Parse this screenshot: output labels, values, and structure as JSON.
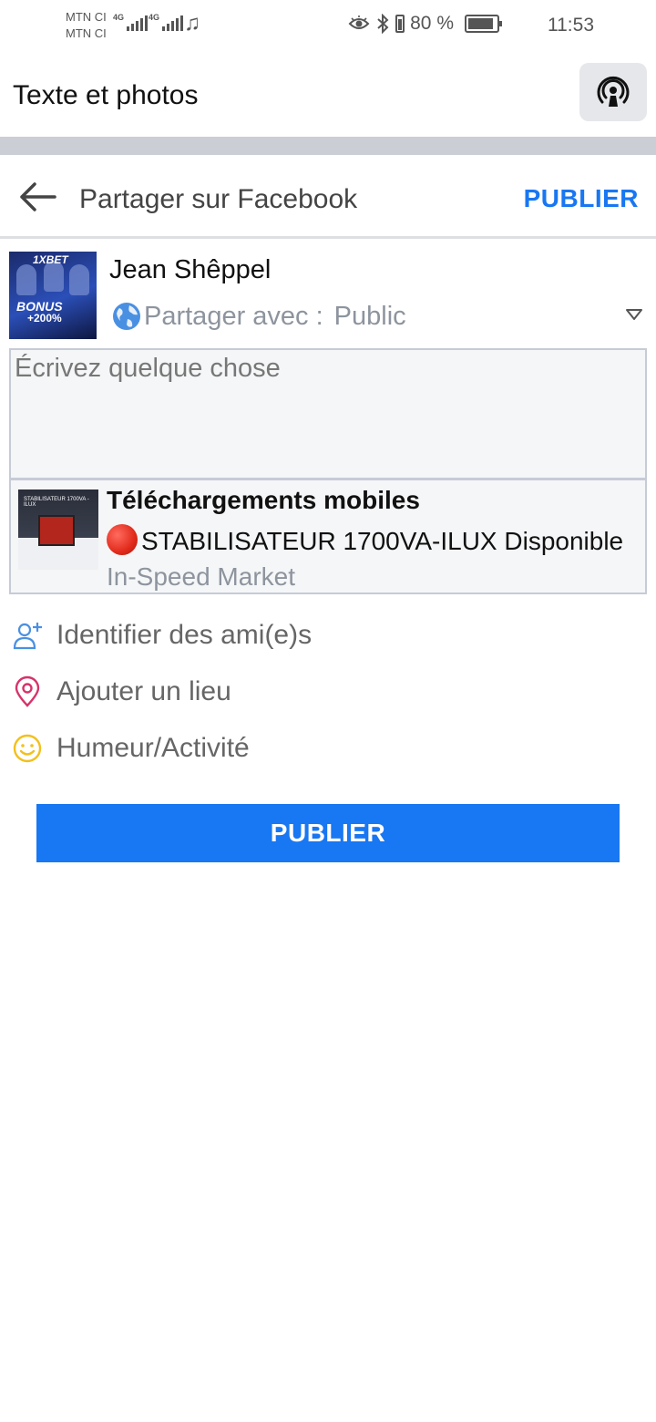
{
  "status_bar": {
    "carrier_1": "MTN CI",
    "carrier_2": "MTN CI",
    "network_1": "4G",
    "network_2": "4G",
    "battery_percent": "80 %",
    "time": "11:53"
  },
  "top_bar": {
    "title": "Texte et photos",
    "action_icon": "broadcast-icon"
  },
  "header": {
    "back_icon": "arrow-left-icon",
    "title": "Partager sur Facebook",
    "publish_label": "PUBLIER"
  },
  "profile": {
    "name": "Jean Shêppel",
    "share_label": "Partager avec :",
    "audience": "Public",
    "avatar_texts": {
      "brand": "1XBET",
      "bonus": "BONUS",
      "percent": "+200%"
    }
  },
  "composer": {
    "placeholder": "Écrivez quelque chose",
    "link_preview": {
      "title": "Téléchargements mobiles",
      "description": "STABILISATEUR 1700VA-ILUX Disponible",
      "source": "In-Speed Market",
      "thumb_text": "STABILISATEUR 1700VA - ILUX"
    }
  },
  "options": [
    {
      "label": "Identifier des ami(e)s",
      "icon": "add-friend-icon",
      "color": "#4a90e2"
    },
    {
      "label": "Ajouter un lieu",
      "icon": "location-pin-icon",
      "color": "#d6336c"
    },
    {
      "label": "Humeur/Activité",
      "icon": "smiley-icon",
      "color": "#f2c01e"
    }
  ],
  "publish_button": {
    "label": "PUBLIER"
  },
  "colors": {
    "accent": "#1877f2",
    "band": "#cbced4",
    "composer_bg": "#f5f6f7"
  }
}
